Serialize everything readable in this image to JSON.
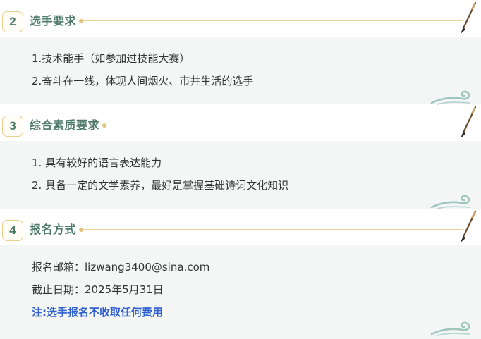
{
  "sections": [
    {
      "number": "2",
      "title": "选手要求",
      "lines": [
        "1.技术能手（如参加过技能大赛）",
        "2.奋斗在一线，体现人间烟火、市井生活的选手"
      ]
    },
    {
      "number": "3",
      "title": "综合素质要求",
      "lines": [
        "1. 具有较好的语言表达能力",
        "2. 具备一定的文学素养，最好是掌握基础诗词文化知识"
      ]
    },
    {
      "number": "4",
      "title": "报名方式",
      "lines": [
        "报名邮箱：lizwang3400@sina.com",
        "截止日期：2025年5月31日"
      ],
      "note": "注:选手报名不收取任何费用"
    }
  ],
  "colors": {
    "accent_green": "#4e7a6a",
    "gold_line": "#e8d49a",
    "panel_bg": "#f3f6f4",
    "note_blue": "#2f5fd0"
  },
  "icons": [
    "calligraphy-brush-icon",
    "cloud-swirl-icon"
  ]
}
